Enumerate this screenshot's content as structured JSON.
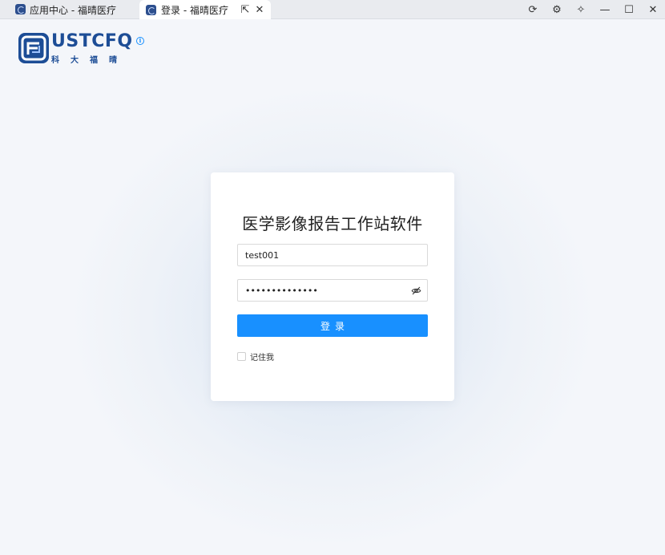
{
  "titlebar": {
    "tabs": [
      {
        "label": "应用中心 - 福晴医疗",
        "active": false
      },
      {
        "label": "登录 - 福晴医疗",
        "active": true
      }
    ],
    "tab_actions": {
      "external_glyph": "⇱",
      "close_glyph": "✕"
    },
    "window_controls": {
      "refresh_glyph": "⟳",
      "settings_glyph": "⚙",
      "pin_glyph": "✧",
      "minimize_glyph": "—",
      "maximize_glyph": "☐",
      "close_glyph": "✕"
    }
  },
  "logo": {
    "brand": "USTCFQ",
    "subtitle": "科大福晴",
    "color": "#1d4d96",
    "info_glyph": "i"
  },
  "login": {
    "title": "医学影像报告工作站软件",
    "username_value": "test001",
    "password_value": "••••••••••••••",
    "submit_label": "登录",
    "remember_label": "记住我",
    "remember_checked": false
  },
  "colors": {
    "accent": "#1890ff",
    "card_bg": "#ffffff",
    "page_bg": "#f4f6fa"
  }
}
